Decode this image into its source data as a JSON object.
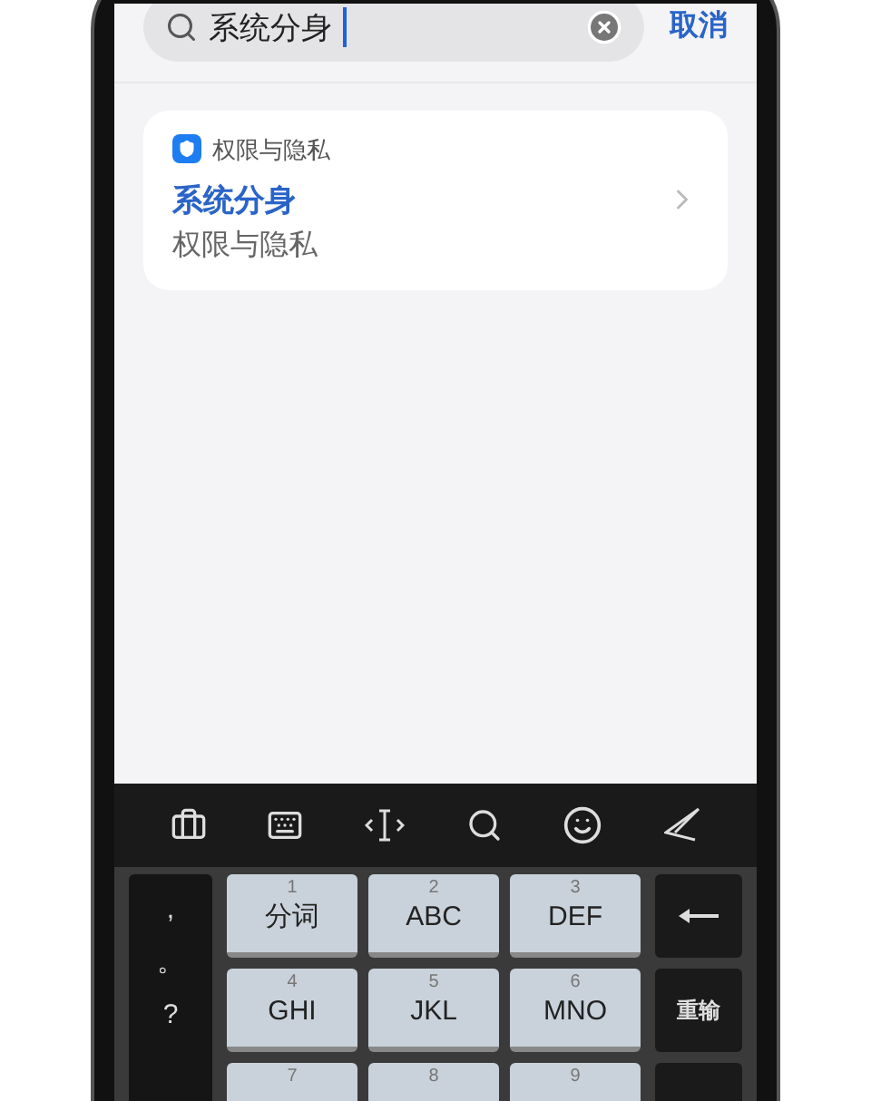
{
  "search": {
    "value": "系统分身"
  },
  "cancel": "取消",
  "result": {
    "category": "权限与隐私",
    "title": "系统分身",
    "subtitle": "权限与隐私"
  },
  "keyboard": {
    "left_keys": [
      ",",
      "。",
      "?"
    ],
    "keys": [
      {
        "digit": "1",
        "label": "分词"
      },
      {
        "digit": "2",
        "label": "ABC"
      },
      {
        "digit": "3",
        "label": "DEF"
      },
      {
        "digit": "4",
        "label": "GHI"
      },
      {
        "digit": "5",
        "label": "JKL"
      },
      {
        "digit": "6",
        "label": "MNO"
      },
      {
        "digit": "7"
      },
      {
        "digit": "8"
      },
      {
        "digit": "9"
      }
    ],
    "right_keys": [
      {
        "kind": "backspace"
      },
      {
        "kind": "text",
        "label": "重输"
      },
      {
        "kind": "blank"
      }
    ]
  }
}
